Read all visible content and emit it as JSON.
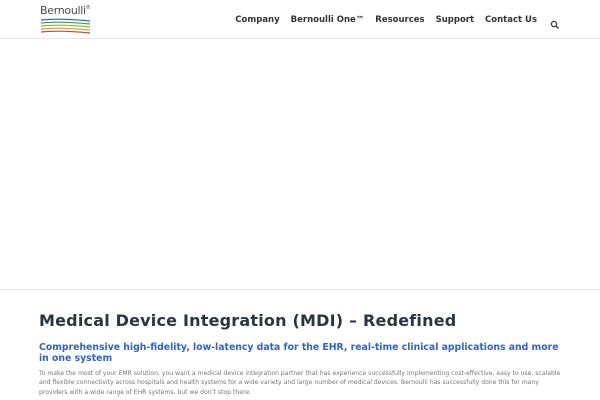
{
  "header": {
    "logo_text": "Bernoulli",
    "logo_mark": "®",
    "nav": [
      {
        "label": "Company"
      },
      {
        "label": "Bernoulli One™"
      },
      {
        "label": "Resources"
      },
      {
        "label": "Support"
      },
      {
        "label": "Contact Us"
      }
    ],
    "search_icon": "search-icon"
  },
  "main": {
    "title": "Medical Device Integration (MDI) – Redefined",
    "subtitle": "Comprehensive high-fidelity, low-latency data for the EHR, real-time clinical applications and more in one system",
    "body": "To make the most of your EMR solution, you want a medical device integration partner that has experience successfully implementing cost-effective, easy to use, scalable and flexible connectivity across hospitals and health systems for a wide variety and large number of medical devices. Bernoulli has successfully done this for many providers with a wide range of EHR systems, but we don’t stop there."
  },
  "colors": {
    "subtitle_blue": "#2f63c9",
    "title_dark": "#2b3440",
    "nav_text": "#333333"
  }
}
